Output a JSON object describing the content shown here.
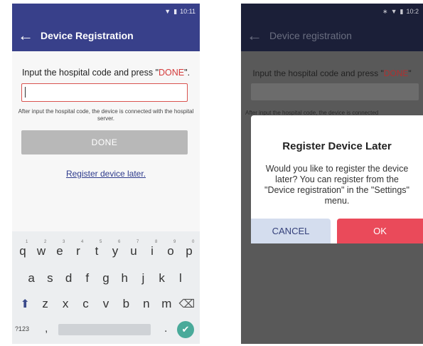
{
  "left_screen": {
    "status": {
      "time": "10:11",
      "wifi_icon": "wifi-icon",
      "battery_icon": "battery-icon"
    },
    "appbar": {
      "back_icon": "arrow-left-icon",
      "title": "Device Registration"
    },
    "instruction": {
      "before": "Input the hospital code and press \"",
      "done_word": "DONE",
      "after": "\"."
    },
    "code_input": {
      "value": "",
      "placeholder": ""
    },
    "hint": "After input the hospital code, the device is connected with the hospital server.",
    "done_button": "DONE",
    "register_later_link": "Register device later.",
    "keyboard": {
      "row1": [
        {
          "key": "q",
          "num": "1"
        },
        {
          "key": "w",
          "num": "2"
        },
        {
          "key": "e",
          "num": "3"
        },
        {
          "key": "r",
          "num": "4"
        },
        {
          "key": "t",
          "num": "5"
        },
        {
          "key": "y",
          "num": "6"
        },
        {
          "key": "u",
          "num": "7"
        },
        {
          "key": "i",
          "num": "8"
        },
        {
          "key": "o",
          "num": "9"
        },
        {
          "key": "p",
          "num": "0"
        }
      ],
      "row2": [
        "a",
        "s",
        "d",
        "f",
        "g",
        "h",
        "j",
        "k",
        "l"
      ],
      "row3": [
        "z",
        "x",
        "c",
        "v",
        "b",
        "n",
        "m"
      ],
      "shift_icon": "shift-icon",
      "delete_icon": "backspace-icon",
      "symbols_key": "?123",
      "comma_key": ",",
      "period_key": ".",
      "enter_icon": "checkmark-icon",
      "accent_color": "#4aaa9a"
    }
  },
  "right_screen": {
    "status": {
      "time": "10:2",
      "bluetooth_icon": "bluetooth-icon",
      "wifi_icon": "wifi-icon",
      "battery_icon": "battery-icon"
    },
    "appbar": {
      "back_icon": "arrow-left-icon",
      "title": "Device registration"
    },
    "instruction": {
      "before": "Input the hospital code and press \"",
      "done_word": "DONE",
      "after": "\""
    },
    "hint": "After input the hospital code, the device is connected",
    "dialog": {
      "title": "Register Device Later",
      "message": "Would you like to register the device later? You can register from the \"Device registration\" in the \"Settings\" menu.",
      "cancel_button": "CANCEL",
      "ok_button": "OK"
    }
  },
  "colors": {
    "primary": "#38408a",
    "primary_dark": "#1b1f38",
    "accent_red": "#d43a3a",
    "ok_button": "#ea4a5a",
    "cancel_button": "#d4ddee"
  }
}
